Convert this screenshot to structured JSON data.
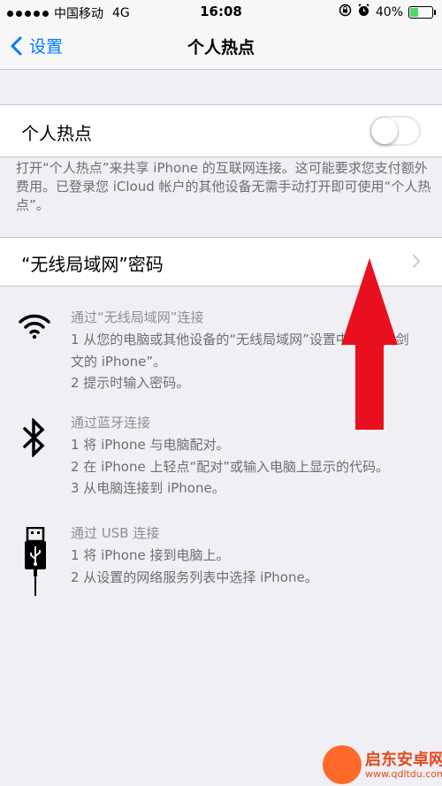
{
  "status_bar": {
    "carrier": "中国移动",
    "network": "4G",
    "time": "16:08",
    "battery": "40%",
    "battery_level": 0.4
  },
  "nav": {
    "back_label": "设置",
    "title": "个人热点"
  },
  "hotspot": {
    "label": "个人热点",
    "enabled": false,
    "footer": "打开“个人热点”来共享 iPhone 的互联网连接。这可能要求您支付额外费用。已登录您 iCloud 帐户的其他设备无需手动打开即可使用“个人热点”。"
  },
  "wifi_password": {
    "label": "“无线局域网”密码"
  },
  "instructions": {
    "wifi": {
      "heading": "通过“无线局域网”连接",
      "steps": [
        "1 从您的电脑或其他设备的“无线局域网”设置中选择“吴剑",
        "文的 iPhone”。",
        "2 提示时输入密码。"
      ]
    },
    "bluetooth": {
      "heading": "通过蓝牙连接",
      "steps": [
        "1 将 iPhone 与电脑配对。",
        "2 在 iPhone 上轻点“配对”或输入电脑上显示的代码。",
        "3 从电脑连接到 iPhone。"
      ]
    },
    "usb": {
      "heading": "通过 USB 连接",
      "steps": [
        "1 将 iPhone 接到电脑上。",
        "2 从设置的网络服务列表中选择 iPhone。"
      ]
    }
  },
  "watermark": {
    "name": "启东安卓网",
    "url": "www.qdltdu.com"
  },
  "colors": {
    "accent": "#007aff",
    "battery_fill": "#4cd964",
    "arrow": "#e8101e"
  },
  "icons": [
    "wifi-icon",
    "bluetooth-icon",
    "usb-icon",
    "back-chevron-icon",
    "chevron-right-icon",
    "alarm-icon",
    "rotation-lock-icon"
  ]
}
